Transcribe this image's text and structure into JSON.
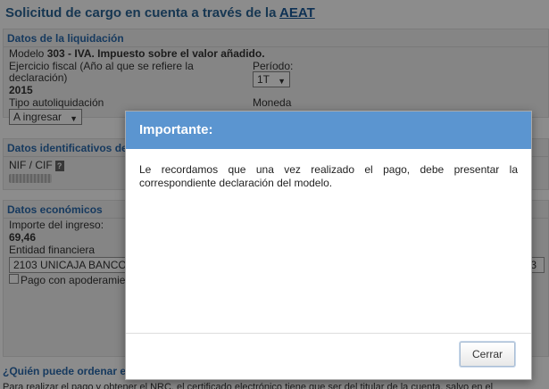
{
  "page": {
    "title_prefix": "Solicitud de cargo en cuenta a través de la ",
    "title_link": "AEAT"
  },
  "liquidacion": {
    "header": "Datos de la liquidación",
    "modelo_prefix": "Modelo ",
    "modelo_value": "303 - IVA. Impuesto sobre el valor añadido.",
    "ejercicio_label_1": "Ejercicio fiscal (Año al que se refiere la",
    "ejercicio_label_2": "declaración)",
    "ejercicio_value": "2015",
    "periodo_label": "Período:",
    "periodo_value": "1T",
    "tipo_label": "Tipo autoliquidación",
    "tipo_value": "A ingresar",
    "moneda_label": "Moneda"
  },
  "identificativos": {
    "header": "Datos identificativos del",
    "nif_label": "NIF / CIF",
    "help_icon": "?"
  },
  "economicos": {
    "header": "Datos económicos",
    "importe_label": "Importe del ingreso:",
    "importe_value": "69,46",
    "entidad_label": "Entidad financiera",
    "entidad_value": "2103 UNICAJA BANCO",
    "entidad_suffix": "3",
    "apoderamiento_label": "Pago con apoderamie"
  },
  "bottom": {
    "link": "¿Quién puede ordenar el",
    "text": "Para realizar el pago y obtener el NRC, el certificado electrónico tiene que ser del titular de la cuenta, salvo en el"
  },
  "modal": {
    "title": "Importante:",
    "body": "Le recordamos que una vez realizado el pago, debe presentar la correspondiente declaración del modelo.",
    "close_label": "Cerrar"
  }
}
